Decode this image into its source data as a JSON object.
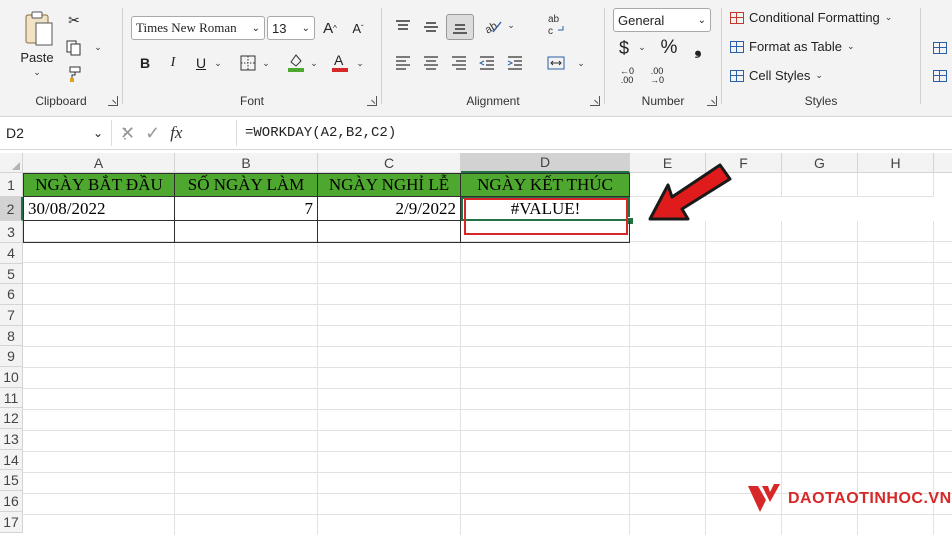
{
  "ribbon": {
    "clipboard": {
      "paste_label": "Paste",
      "group_label": "Clipboard"
    },
    "font": {
      "family": "Times New Roman",
      "size": "13",
      "group_label": "Font",
      "bold": "B",
      "italic": "I",
      "underline": "U",
      "fill_color": "#4ea72e",
      "font_color": "#d62828"
    },
    "alignment": {
      "group_label": "Alignment"
    },
    "number": {
      "format": "General",
      "currency": "$",
      "percent": "%",
      "comma": "❟",
      "inc_decimal": "←0 .00",
      "dec_decimal": ".00 →0",
      "group_label": "Number"
    },
    "styles": {
      "conditional": "Conditional Formatting",
      "format_table": "Format as Table",
      "cell_styles": "Cell Styles",
      "group_label": "Styles"
    }
  },
  "formula_bar": {
    "name_box": "D2",
    "formula": "=WORKDAY(A2,B2,C2)",
    "fx": "fx"
  },
  "sheet": {
    "columns": [
      "A",
      "B",
      "C",
      "D",
      "E",
      "F",
      "G",
      "H"
    ],
    "rows": [
      "1",
      "2",
      "3",
      "4",
      "5",
      "6",
      "7",
      "8",
      "9",
      "10",
      "11",
      "12",
      "13",
      "14",
      "15",
      "16",
      "17"
    ],
    "header_row": [
      "NGÀY BẮT ĐẦU",
      "SỐ NGÀY LÀM",
      "NGÀY NGHỈ LỄ",
      "NGÀY KẾT THÚC"
    ],
    "data_row": [
      "30/08/2022",
      "7",
      "2/9/2022",
      "#VALUE!"
    ],
    "header_fill": "#4ea72e",
    "highlight_color": "#d62828"
  },
  "watermark": {
    "brand": "DAOTAOTINHOC.VN"
  }
}
